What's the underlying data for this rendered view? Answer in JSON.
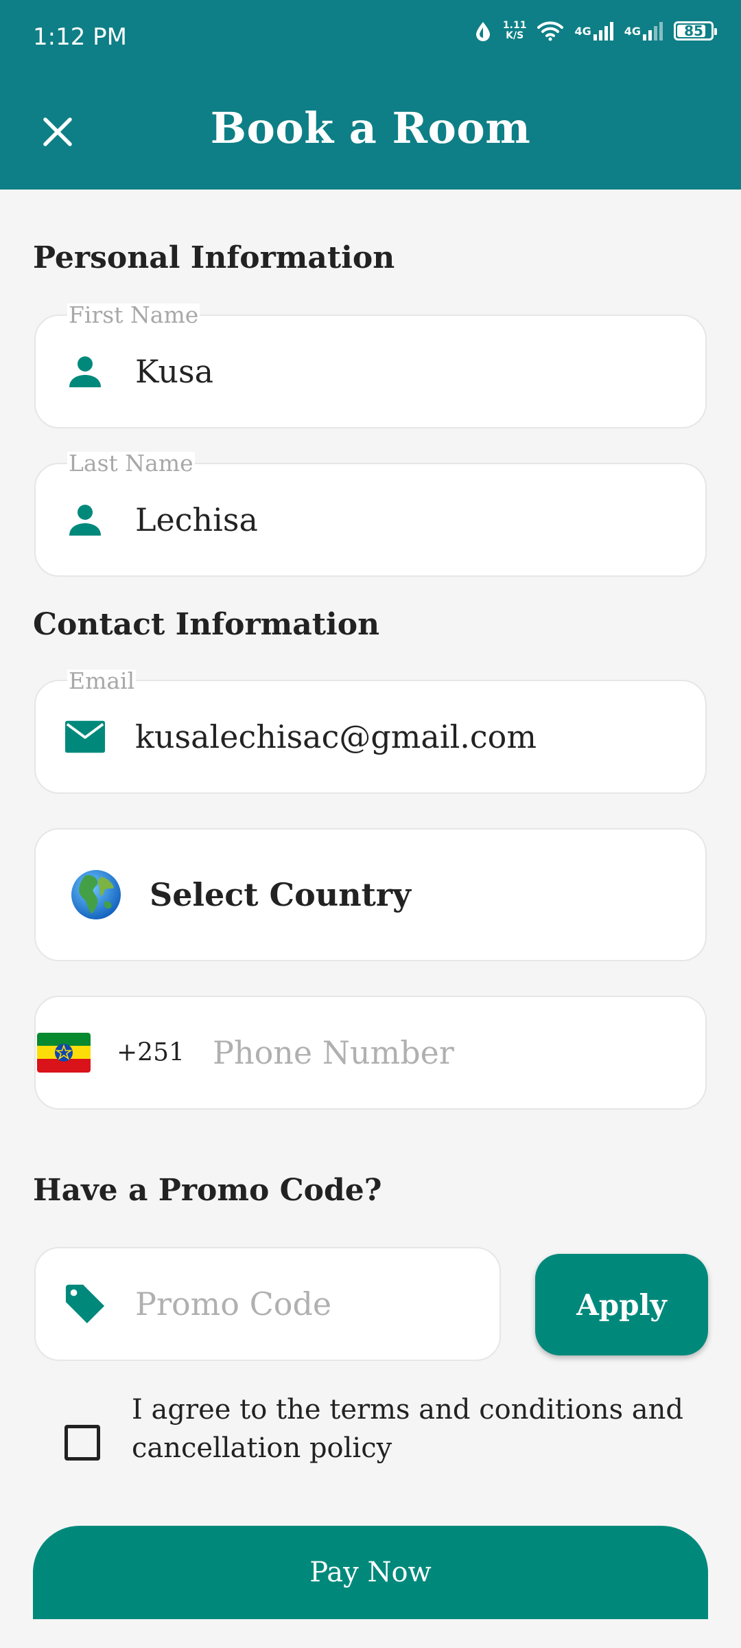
{
  "status_bar": {
    "time": "1:12 PM",
    "net_speed_value": "1.11",
    "net_speed_unit": "K/S",
    "network_1": "4G",
    "network_2": "4G",
    "battery": "85",
    "battery_level_pct": 85
  },
  "header": {
    "title": "Book a Room",
    "close_icon": "close-icon"
  },
  "personal": {
    "section_title": "Personal Information",
    "first_name": {
      "label": "First Name",
      "value": "Kusa",
      "icon": "person-icon"
    },
    "last_name": {
      "label": "Last Name",
      "value": "Lechisa",
      "icon": "person-icon"
    }
  },
  "contact": {
    "section_title": "Contact Information",
    "email": {
      "label": "Email",
      "value": "kusalechisac@gmail.com",
      "icon": "mail-icon"
    },
    "country": {
      "label": "Select Country",
      "icon": "globe-icon"
    },
    "phone": {
      "dial_code": "+251",
      "placeholder": "Phone Number",
      "flag": "ethiopia-flag-icon"
    }
  },
  "promo": {
    "section_title": "Have a Promo Code?",
    "placeholder": "Promo Code",
    "icon": "tag-icon",
    "apply_label": "Apply"
  },
  "terms": {
    "text": "I agree to the terms and conditions and cancellation policy",
    "checked": false
  },
  "pay": {
    "label": "Pay Now"
  },
  "colors": {
    "header": "#0e7f86",
    "accent": "#00897b",
    "background": "#f5f5f5"
  }
}
